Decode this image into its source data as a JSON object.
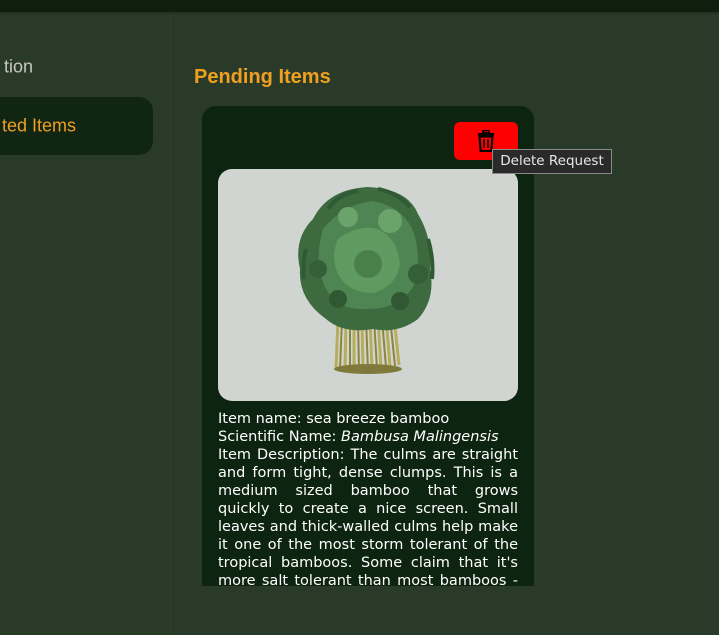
{
  "sidebar": {
    "items": [
      {
        "label": "tion"
      },
      {
        "label": "ted Items"
      }
    ]
  },
  "main": {
    "title": "Pending Items",
    "card": {
      "delete_icon": "trash-icon",
      "name_label": "Item name: ",
      "name_value": "sea breeze bamboo",
      "scientific_label": "Scientific Name: ",
      "scientific_value": "Bambusa Malingensis",
      "description_label": "Item Description: ",
      "description_value": "The culms are straight and form tight, dense clumps. This is a medium sized bamboo that grows quickly to create a nice screen. Small leaves and thick-walled culms help make it one of the most storm tolerant of the tropical bamboos. Some claim that it's more salt tolerant than most bamboos - it certainly"
    }
  },
  "tooltip": {
    "text": "Delete Request"
  },
  "colors": {
    "accent": "#f0a020",
    "background": "#2a3a28",
    "card": "#0d2510",
    "delete": "#ff0000"
  }
}
